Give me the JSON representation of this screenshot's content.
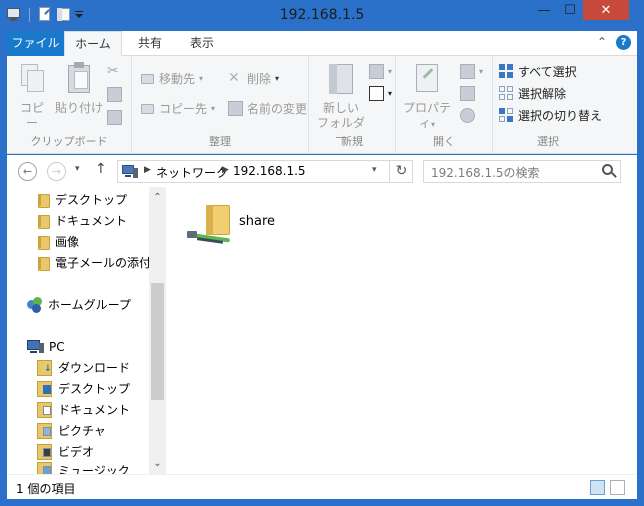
{
  "window": {
    "title": "192.168.1.5"
  },
  "title_buttons": {
    "minimize": "—",
    "maximize": "☐",
    "close": "✕"
  },
  "tabs": [
    "ファイル",
    "ホーム",
    "共有",
    "表示"
  ],
  "ribbon": {
    "clipboard": {
      "label": "クリップボード",
      "copy": "コピー",
      "paste": "貼り付け"
    },
    "organize": {
      "label": "整理",
      "move_to": "移動先",
      "copy_to": "コピー先",
      "delete": "削除",
      "rename": "名前の変更"
    },
    "new": {
      "label": "新規",
      "new_folder_line1": "新しい",
      "new_folder_line2": "フォルダー"
    },
    "open": {
      "label": "開く",
      "properties": "プロパティ"
    },
    "select": {
      "label": "選択",
      "select_all": "すべて選択",
      "select_none": "選択解除",
      "invert": "選択の切り替え"
    }
  },
  "address": {
    "crumbs": [
      "ネットワーク",
      "192.168.1.5"
    ]
  },
  "search": {
    "placeholder": "192.168.1.5の検索"
  },
  "nav": {
    "quick": [
      "デスクトップ",
      "ドキュメント",
      "画像",
      "電子メールの添付フ"
    ],
    "homegroup": "ホームグループ",
    "pc": "PC",
    "pc_items": [
      "ダウンロード",
      "デスクトップ",
      "ドキュメント",
      "ピクチャ",
      "ビデオ",
      "ミュージック"
    ]
  },
  "items": [
    {
      "name": "share"
    }
  ],
  "status": {
    "count": "1 個の項目"
  },
  "colors": {
    "titlebar": "#2b71c9",
    "file_tab": "#1979ca",
    "close": "#c7493b"
  }
}
